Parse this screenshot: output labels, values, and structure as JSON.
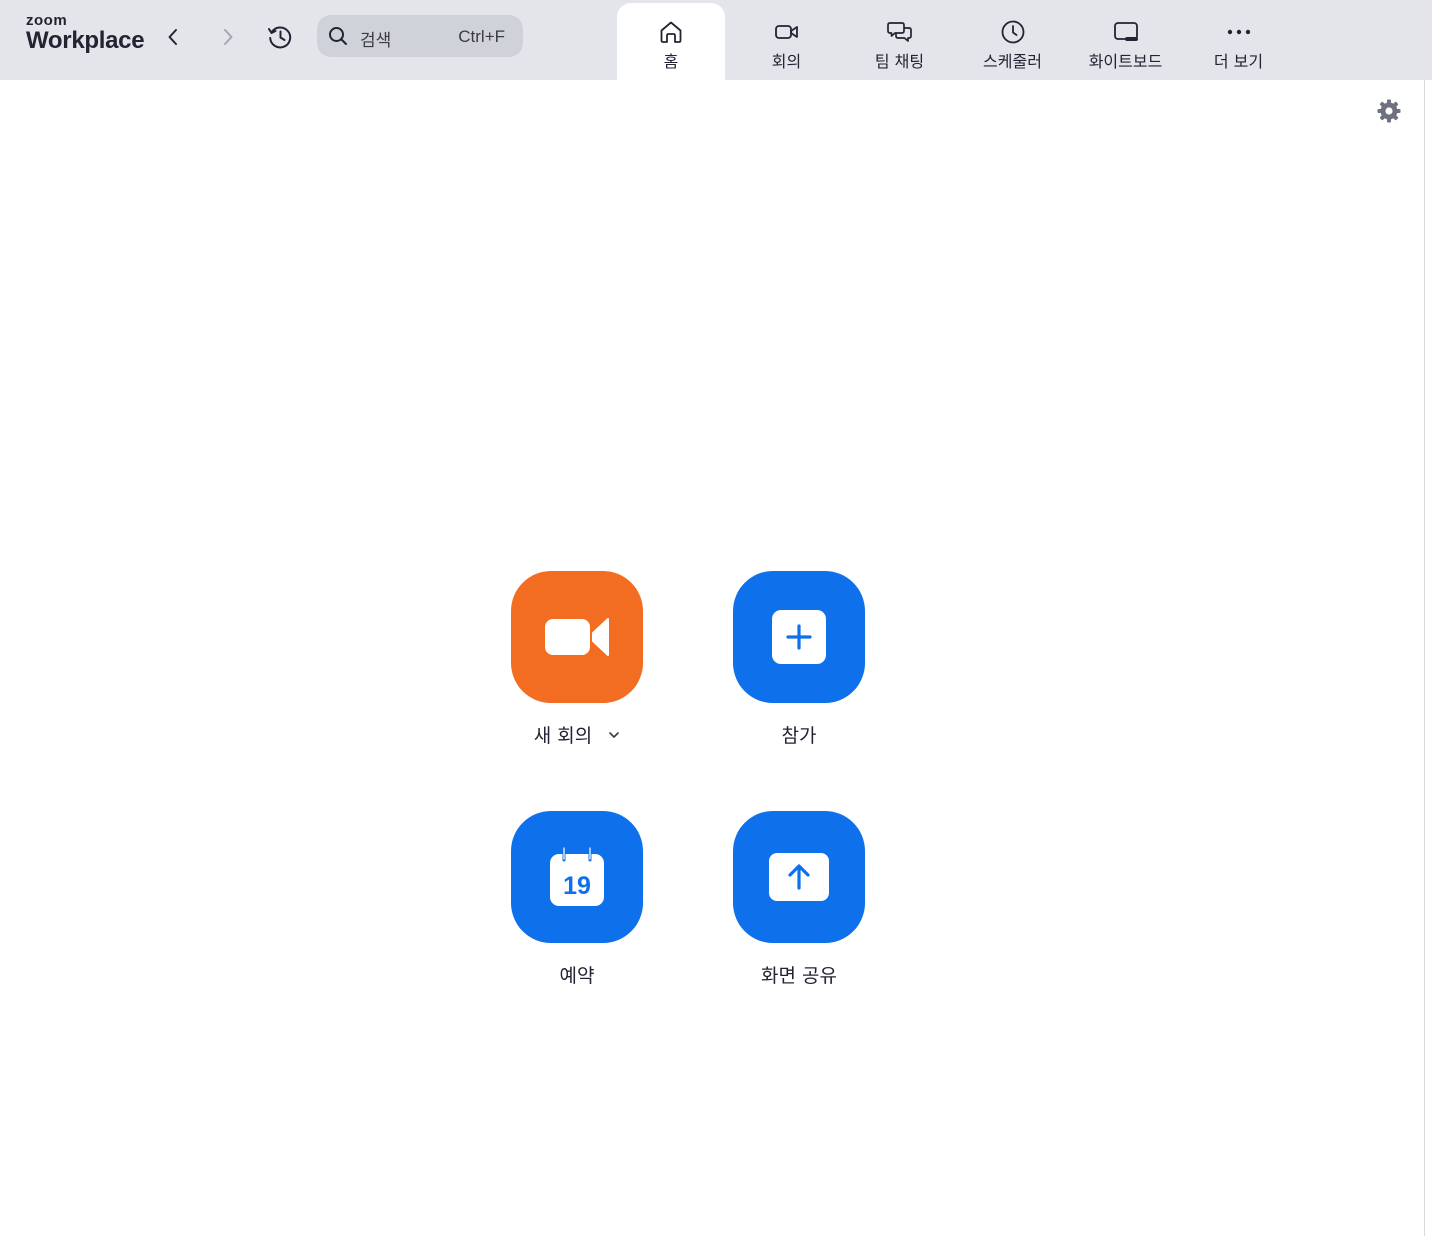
{
  "app": {
    "logo_top": "zoom",
    "logo_product": "Workplace"
  },
  "search": {
    "placeholder": "검색",
    "shortcut": "Ctrl+F"
  },
  "tabs": [
    {
      "label": "홈",
      "icon": "home-icon",
      "active": true
    },
    {
      "label": "회의",
      "icon": "video-camera-icon"
    },
    {
      "label": "팀 채팅",
      "icon": "chat-bubbles-icon"
    },
    {
      "label": "스케줄러",
      "icon": "clock-icon"
    },
    {
      "label": "화이트보드",
      "icon": "whiteboard-icon"
    },
    {
      "label": "더 보기",
      "icon": "more-dots-icon"
    }
  ],
  "actions": {
    "new_meeting": {
      "label": "새 회의",
      "color": "#f26d21"
    },
    "join": {
      "label": "참가",
      "color": "#0e71eb"
    },
    "schedule": {
      "label": "예약",
      "color": "#0e71eb",
      "calendar_day": "19"
    },
    "share_screen": {
      "label": "화면 공유",
      "color": "#0e71eb"
    }
  },
  "colors": {
    "topbar_bg": "#e3e5ea",
    "accent_blue": "#0e71eb",
    "accent_orange": "#f26d21"
  }
}
